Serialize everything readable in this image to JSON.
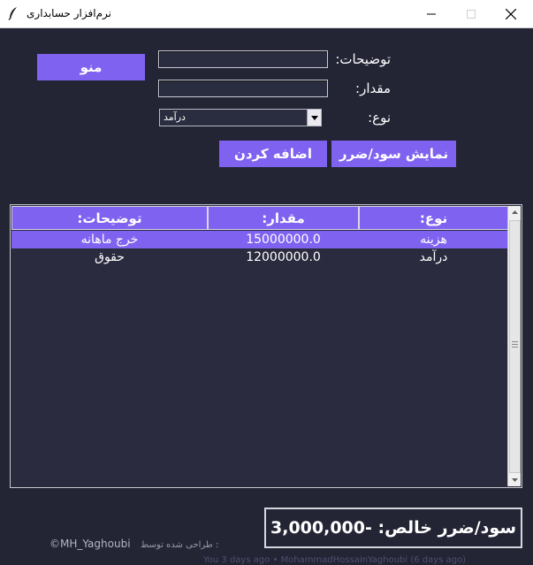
{
  "window": {
    "title": "نرم‌افزار حسابداری",
    "minimize_icon": "minimize-icon",
    "maximize_icon": "maximize-icon",
    "close_icon": "close-icon"
  },
  "menu_button": "منو",
  "form": {
    "description_label": "توضیحات:",
    "description_value": "",
    "amount_label": "مقدار:",
    "amount_value": "",
    "type_label": "نوع:",
    "type_selected": "درآمد"
  },
  "buttons": {
    "add": "اضافه کردن",
    "show_profit_loss": "نمایش سود/ضرر"
  },
  "table": {
    "columns": [
      "توضیحات:",
      "مقدار:",
      "نوع:"
    ],
    "rows": [
      {
        "description": "خرج ماهانه",
        "amount": "15000000.0",
        "type": "هزینه",
        "selected": true
      },
      {
        "description": "حقوق",
        "amount": "12000000.0",
        "type": "درآمد",
        "selected": false
      }
    ]
  },
  "result": "سود/ضرر خالص: -3,000,000",
  "footer": {
    "designed_by": "طراحی شده توسط :",
    "author": "©MH_Yaghoubi"
  },
  "background_text": "You 3 days ago   •   MohammadHossainYaghoubi (6 days ago)",
  "colors": {
    "accent": "#7f63f0",
    "background": "#232535"
  }
}
